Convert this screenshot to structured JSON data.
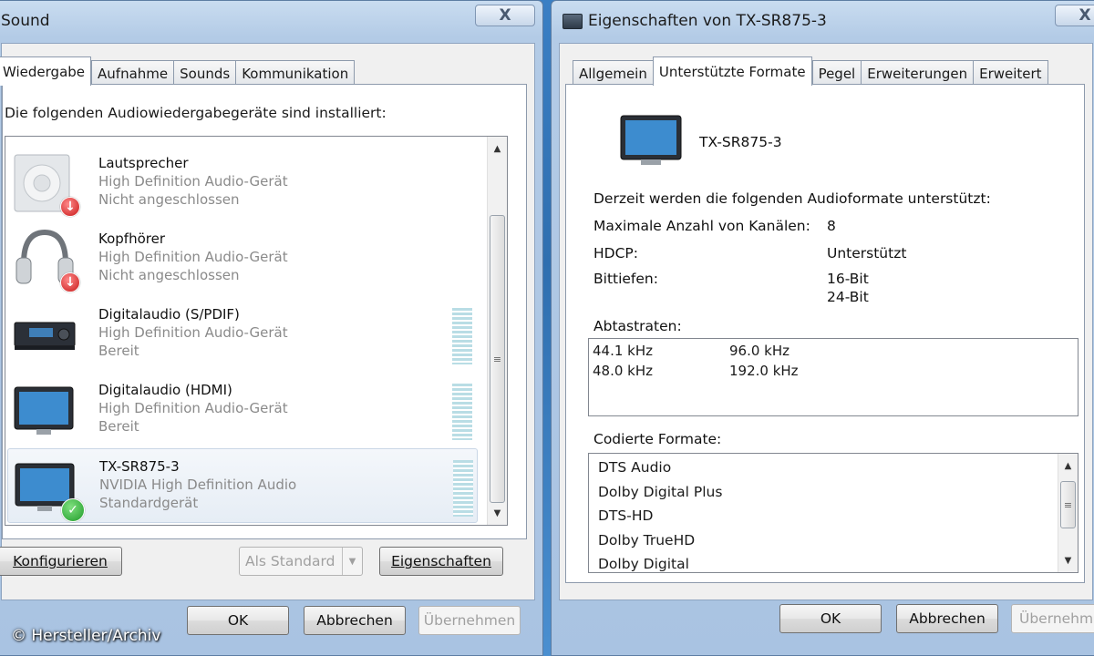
{
  "sound_window": {
    "title": "Sound",
    "close": "X",
    "tabs": [
      "Wiedergabe",
      "Aufnahme",
      "Sounds",
      "Kommunikation"
    ],
    "intro": "Die folgenden Audiowiedergabegeräte sind installiert:",
    "devices": [
      {
        "name": "Lautsprecher",
        "driver": "High Definition Audio-Gerät",
        "status": "Nicht angeschlossen",
        "icon": "speaker-icon",
        "badge": "disconnected"
      },
      {
        "name": "Kopfhörer",
        "driver": "High Definition Audio-Gerät",
        "status": "Nicht angeschlossen",
        "icon": "headphones-icon",
        "badge": "disconnected"
      },
      {
        "name": "Digitalaudio (S/PDIF)",
        "driver": "High Definition Audio-Gerät",
        "status": "Bereit",
        "icon": "receiver-icon",
        "badge": ""
      },
      {
        "name": "Digitalaudio (HDMI)",
        "driver": "High Definition Audio-Gerät",
        "status": "Bereit",
        "icon": "monitor-icon",
        "badge": ""
      },
      {
        "name": "TX-SR875-3",
        "driver": "NVIDIA High Definition Audio",
        "status": "Standardgerät",
        "icon": "monitor-icon",
        "badge": "default"
      }
    ],
    "buttons": {
      "configure": "Konfigurieren",
      "set_default": "Als Standard",
      "properties": "Eigenschaften",
      "ok": "OK",
      "cancel": "Abbrechen",
      "apply": "Übernehmen"
    }
  },
  "props_window": {
    "title": "Eigenschaften von TX-SR875-3",
    "close": "X",
    "tabs": [
      "Allgemein",
      "Unterstützte Formate",
      "Pegel",
      "Erweiterungen",
      "Erweitert"
    ],
    "device_name": "TX-SR875-3",
    "heading": "Derzeit werden die folgenden Audioformate unterstützt:",
    "max_channels_label": "Maximale Anzahl von Kanälen:",
    "max_channels_value": "8",
    "hdcp_label": "HDCP:",
    "hdcp_value": "Unterstützt",
    "bit_depth_label": "Bittiefen:",
    "bit_depths": [
      "16-Bit",
      "24-Bit"
    ],
    "sample_rates_label": "Abtastraten:",
    "sample_rates": [
      "44.1 kHz",
      "96.0 kHz",
      "48.0 kHz",
      "192.0 kHz"
    ],
    "encoded_label": "Codierte Formate:",
    "encoded_formats": [
      "DTS Audio",
      "Dolby Digital Plus",
      "DTS-HD",
      "Dolby TrueHD",
      "Dolby Digital"
    ],
    "buttons": {
      "ok": "OK",
      "cancel": "Abbrechen",
      "apply": "Übernehmen"
    }
  },
  "copyright": "© Hersteller/Archiv"
}
